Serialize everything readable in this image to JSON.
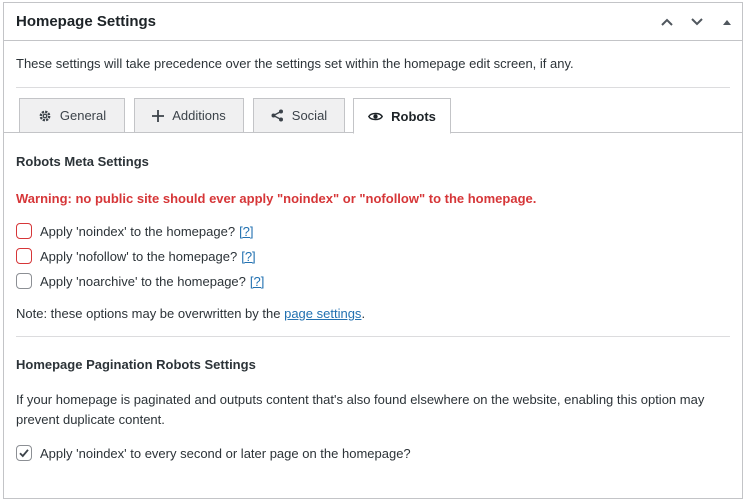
{
  "header": {
    "title": "Homepage Settings"
  },
  "intro": "These settings will take precedence over the settings set within the homepage edit screen, if any.",
  "tabs": [
    {
      "label": "General",
      "icon": "gear-icon"
    },
    {
      "label": "Additions",
      "icon": "plus-icon"
    },
    {
      "label": "Social",
      "icon": "share-icon"
    },
    {
      "label": "Robots",
      "icon": "eye-icon",
      "active": true
    }
  ],
  "robots": {
    "heading": "Robots Meta Settings",
    "warning": "Warning: no public site should ever apply \"noindex\" or \"nofollow\" to the homepage.",
    "options": [
      {
        "label": "Apply 'noindex' to the homepage?",
        "help": "[?]",
        "checked": false
      },
      {
        "label": "Apply 'nofollow' to the homepage?",
        "help": "[?]",
        "checked": false
      },
      {
        "label": "Apply 'noarchive' to the homepage?",
        "help": "[?]",
        "checked": false
      }
    ],
    "note_prefix": "Note: these options may be overwritten by the ",
    "note_link": "page settings",
    "note_suffix": "."
  },
  "pagination": {
    "heading": "Homepage Pagination Robots Settings",
    "description": "If your homepage is paginated and outputs content that's also found elsewhere on the website, enabling this option may prevent duplicate content.",
    "option_label": "Apply 'noindex' to every second or later page on the homepage?",
    "option_checked": true
  },
  "colors": {
    "warning": "#d63638",
    "link": "#2271b1",
    "border": "#c3c4c7"
  }
}
